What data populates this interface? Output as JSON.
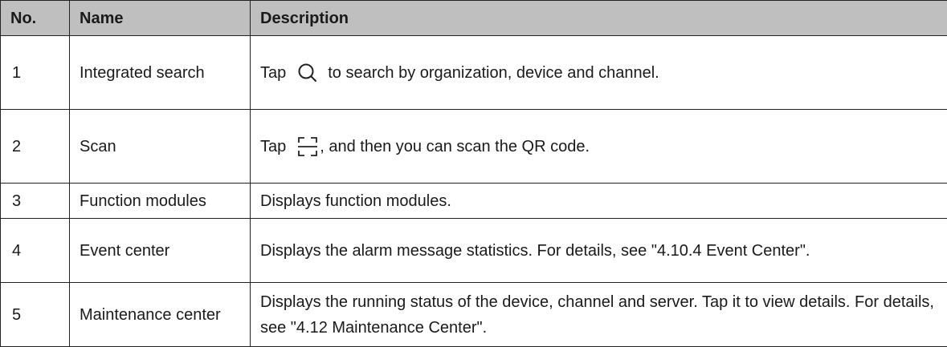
{
  "table": {
    "headers": [
      "No.",
      "Name",
      "Description"
    ],
    "rows": [
      {
        "no": "1",
        "name": "Integrated search",
        "desc_prefix": "Tap",
        "desc_suffix": "to search by organization, device and channel.",
        "icon": "search-icon"
      },
      {
        "no": "2",
        "name": "Scan",
        "desc_prefix": "Tap",
        "desc_suffix": ", and then you can scan the QR code.",
        "icon": "scan-icon"
      },
      {
        "no": "3",
        "name": "Function modules",
        "desc": "Displays function modules."
      },
      {
        "no": "4",
        "name": "Event center",
        "desc": "Displays the alarm message statistics. For details, see \"4.10.4 Event Center\"."
      },
      {
        "no": "5",
        "name": "Maintenance center",
        "desc": "Displays the running status of the device, channel and server. Tap it to view details. For details, see \"4.12 Maintenance Center\"."
      }
    ]
  },
  "colors": {
    "header_bg": "#bfbfbf",
    "border": "#222222",
    "text": "#1a1a1a"
  }
}
